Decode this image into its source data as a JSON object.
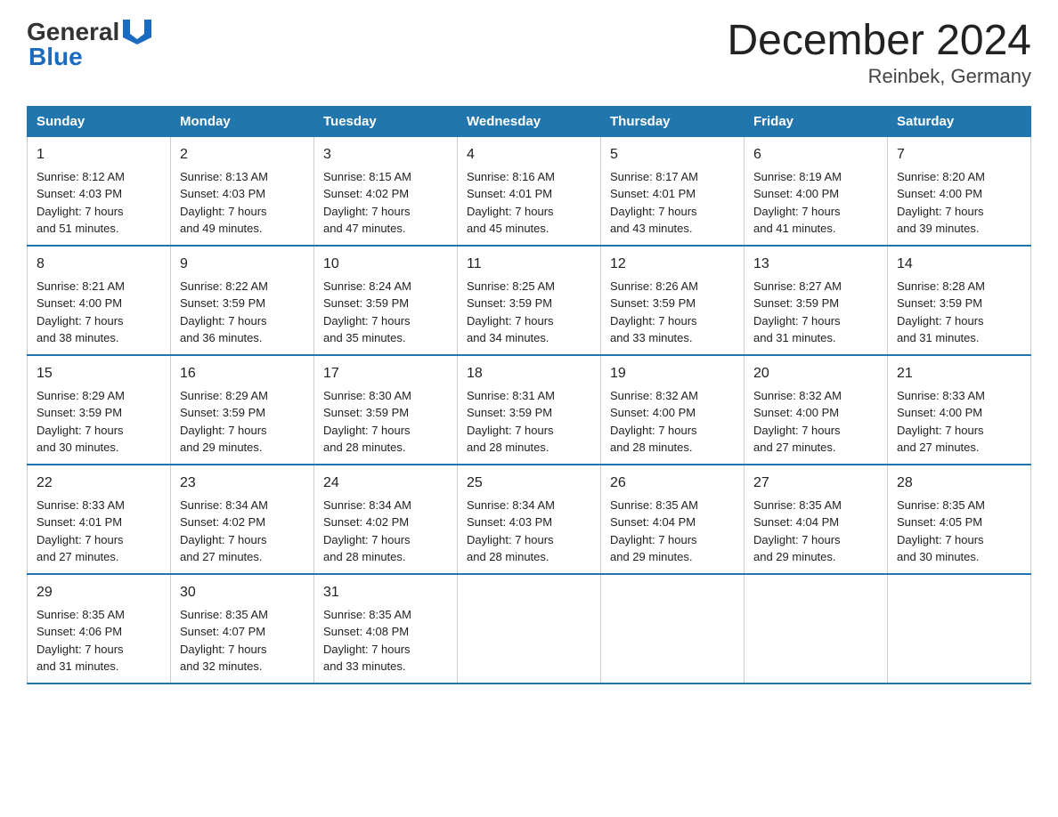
{
  "header": {
    "logo_general": "General",
    "logo_blue": "Blue",
    "title": "December 2024",
    "subtitle": "Reinbek, Germany"
  },
  "days_of_week": [
    "Sunday",
    "Monday",
    "Tuesday",
    "Wednesday",
    "Thursday",
    "Friday",
    "Saturday"
  ],
  "weeks": [
    [
      {
        "day": "1",
        "sunrise": "8:12 AM",
        "sunset": "4:03 PM",
        "daylight": "7 hours and 51 minutes."
      },
      {
        "day": "2",
        "sunrise": "8:13 AM",
        "sunset": "4:03 PM",
        "daylight": "7 hours and 49 minutes."
      },
      {
        "day": "3",
        "sunrise": "8:15 AM",
        "sunset": "4:02 PM",
        "daylight": "7 hours and 47 minutes."
      },
      {
        "day": "4",
        "sunrise": "8:16 AM",
        "sunset": "4:01 PM",
        "daylight": "7 hours and 45 minutes."
      },
      {
        "day": "5",
        "sunrise": "8:17 AM",
        "sunset": "4:01 PM",
        "daylight": "7 hours and 43 minutes."
      },
      {
        "day": "6",
        "sunrise": "8:19 AM",
        "sunset": "4:00 PM",
        "daylight": "7 hours and 41 minutes."
      },
      {
        "day": "7",
        "sunrise": "8:20 AM",
        "sunset": "4:00 PM",
        "daylight": "7 hours and 39 minutes."
      }
    ],
    [
      {
        "day": "8",
        "sunrise": "8:21 AM",
        "sunset": "4:00 PM",
        "daylight": "7 hours and 38 minutes."
      },
      {
        "day": "9",
        "sunrise": "8:22 AM",
        "sunset": "3:59 PM",
        "daylight": "7 hours and 36 minutes."
      },
      {
        "day": "10",
        "sunrise": "8:24 AM",
        "sunset": "3:59 PM",
        "daylight": "7 hours and 35 minutes."
      },
      {
        "day": "11",
        "sunrise": "8:25 AM",
        "sunset": "3:59 PM",
        "daylight": "7 hours and 34 minutes."
      },
      {
        "day": "12",
        "sunrise": "8:26 AM",
        "sunset": "3:59 PM",
        "daylight": "7 hours and 33 minutes."
      },
      {
        "day": "13",
        "sunrise": "8:27 AM",
        "sunset": "3:59 PM",
        "daylight": "7 hours and 31 minutes."
      },
      {
        "day": "14",
        "sunrise": "8:28 AM",
        "sunset": "3:59 PM",
        "daylight": "7 hours and 31 minutes."
      }
    ],
    [
      {
        "day": "15",
        "sunrise": "8:29 AM",
        "sunset": "3:59 PM",
        "daylight": "7 hours and 30 minutes."
      },
      {
        "day": "16",
        "sunrise": "8:29 AM",
        "sunset": "3:59 PM",
        "daylight": "7 hours and 29 minutes."
      },
      {
        "day": "17",
        "sunrise": "8:30 AM",
        "sunset": "3:59 PM",
        "daylight": "7 hours and 28 minutes."
      },
      {
        "day": "18",
        "sunrise": "8:31 AM",
        "sunset": "3:59 PM",
        "daylight": "7 hours and 28 minutes."
      },
      {
        "day": "19",
        "sunrise": "8:32 AM",
        "sunset": "4:00 PM",
        "daylight": "7 hours and 28 minutes."
      },
      {
        "day": "20",
        "sunrise": "8:32 AM",
        "sunset": "4:00 PM",
        "daylight": "7 hours and 27 minutes."
      },
      {
        "day": "21",
        "sunrise": "8:33 AM",
        "sunset": "4:00 PM",
        "daylight": "7 hours and 27 minutes."
      }
    ],
    [
      {
        "day": "22",
        "sunrise": "8:33 AM",
        "sunset": "4:01 PM",
        "daylight": "7 hours and 27 minutes."
      },
      {
        "day": "23",
        "sunrise": "8:34 AM",
        "sunset": "4:02 PM",
        "daylight": "7 hours and 27 minutes."
      },
      {
        "day": "24",
        "sunrise": "8:34 AM",
        "sunset": "4:02 PM",
        "daylight": "7 hours and 28 minutes."
      },
      {
        "day": "25",
        "sunrise": "8:34 AM",
        "sunset": "4:03 PM",
        "daylight": "7 hours and 28 minutes."
      },
      {
        "day": "26",
        "sunrise": "8:35 AM",
        "sunset": "4:04 PM",
        "daylight": "7 hours and 29 minutes."
      },
      {
        "day": "27",
        "sunrise": "8:35 AM",
        "sunset": "4:04 PM",
        "daylight": "7 hours and 29 minutes."
      },
      {
        "day": "28",
        "sunrise": "8:35 AM",
        "sunset": "4:05 PM",
        "daylight": "7 hours and 30 minutes."
      }
    ],
    [
      {
        "day": "29",
        "sunrise": "8:35 AM",
        "sunset": "4:06 PM",
        "daylight": "7 hours and 31 minutes."
      },
      {
        "day": "30",
        "sunrise": "8:35 AM",
        "sunset": "4:07 PM",
        "daylight": "7 hours and 32 minutes."
      },
      {
        "day": "31",
        "sunrise": "8:35 AM",
        "sunset": "4:08 PM",
        "daylight": "7 hours and 33 minutes."
      },
      null,
      null,
      null,
      null
    ]
  ],
  "labels": {
    "sunrise": "Sunrise:",
    "sunset": "Sunset:",
    "daylight": "Daylight:"
  }
}
